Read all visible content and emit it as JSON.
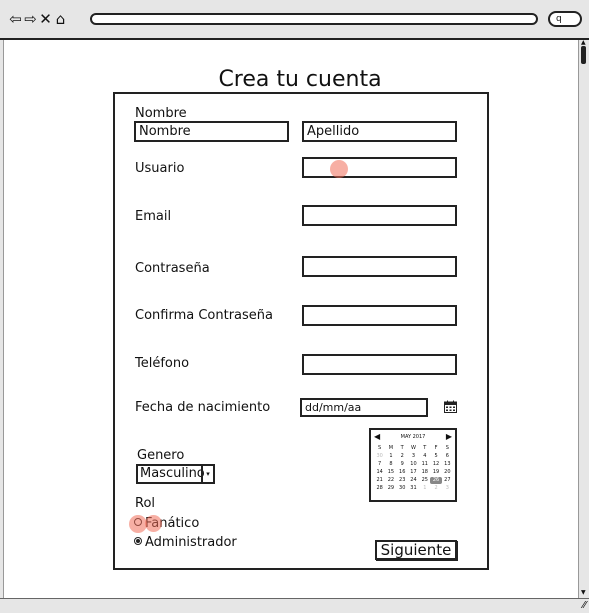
{
  "page_title": "Crea tu cuenta",
  "nav": {
    "back_icon": "back-arrow-icon",
    "forward_icon": "forward-arrow-icon",
    "stop_icon": "close-icon",
    "home_icon": "home-icon",
    "search_glyph": "q"
  },
  "form": {
    "nombre_label": "Nombre",
    "nombre_placeholder": "Nombre",
    "apellido_placeholder": "Apellido",
    "usuario_label": "Usuario",
    "email_label": "Email",
    "contrasena_label": "Contraseña",
    "confirma_label": "Confirma Contraseña",
    "telefono_label": "Teléfono",
    "fecha_label": "Fecha de nacimiento",
    "fecha_placeholder": "dd/mm/aa",
    "genero_label": "Genero",
    "genero_value": "Masculino",
    "rol_label": "Rol",
    "rol_options": [
      "Fanático",
      "Administrador"
    ],
    "submit_label": "Siguiente"
  },
  "calendar": {
    "month_label": "MAY 2017",
    "weekdays": [
      "S",
      "M",
      "T",
      "W",
      "T",
      "F",
      "S"
    ],
    "days": [
      "30",
      "1",
      "2",
      "3",
      "4",
      "5",
      "6",
      "7",
      "8",
      "9",
      "10",
      "11",
      "12",
      "13",
      "14",
      "15",
      "16",
      "17",
      "18",
      "19",
      "20",
      "21",
      "22",
      "23",
      "24",
      "25",
      "26",
      "27",
      "28",
      "29",
      "30",
      "31",
      "1",
      "2",
      "3"
    ],
    "selected_day": "26"
  },
  "colors": {
    "accent_cursor": "#f06e5a",
    "chrome": "#e6e6e6"
  }
}
